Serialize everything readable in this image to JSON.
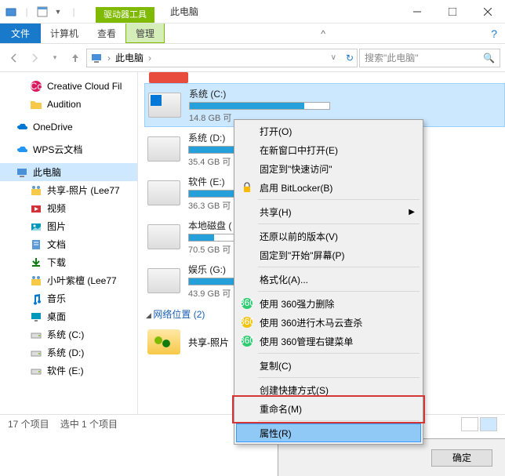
{
  "titlebar": {
    "context_tab": "驱动器工具",
    "context_title": "此电脑"
  },
  "ribbon": {
    "file": "文件",
    "tabs": [
      "计算机",
      "查看",
      "管理"
    ]
  },
  "nav": {
    "breadcrumb": "此电脑",
    "search_placeholder": "搜索\"此电脑\""
  },
  "tree": [
    {
      "label": "Creative Cloud Fil",
      "type": "cc",
      "child": true
    },
    {
      "label": "Audition",
      "type": "folder",
      "child": true
    },
    {
      "label": "",
      "spacer": true
    },
    {
      "label": "OneDrive",
      "type": "onedrive",
      "child": false
    },
    {
      "label": "",
      "spacer": true
    },
    {
      "label": "WPS云文档",
      "type": "wps",
      "child": false
    },
    {
      "label": "",
      "spacer": true
    },
    {
      "label": "此电脑",
      "type": "pc",
      "child": false,
      "selected": true
    },
    {
      "label": "共享-照片 (Lee77",
      "type": "share",
      "child": true
    },
    {
      "label": "视频",
      "type": "video",
      "child": true
    },
    {
      "label": "图片",
      "type": "pictures",
      "child": true
    },
    {
      "label": "文档",
      "type": "docs",
      "child": true
    },
    {
      "label": "下载",
      "type": "downloads",
      "child": true
    },
    {
      "label": "小叶紫檀 (Lee77",
      "type": "share",
      "child": true
    },
    {
      "label": "音乐",
      "type": "music",
      "child": true
    },
    {
      "label": "桌面",
      "type": "desktop",
      "child": true
    },
    {
      "label": "系统 (C:)",
      "type": "drive",
      "child": true
    },
    {
      "label": "系统 (D:)",
      "type": "drive",
      "child": true
    },
    {
      "label": "软件 (E:)",
      "type": "drive",
      "child": true
    }
  ],
  "drives": [
    {
      "name": "系统 (C:)",
      "size": "14.8 GB 可",
      "fill": 82,
      "selected": true,
      "win": true
    },
    {
      "name": "系统 (D:)",
      "size": "35.4 GB 可",
      "fill": 64
    },
    {
      "name": "软件 (E:)",
      "size": "36.3 GB 可",
      "fill": 62
    },
    {
      "name": "本地磁盘 (",
      "size": "70.5 GB 可",
      "fill": 18
    },
    {
      "name": "娱乐 (G:)",
      "size": "43.9 GB 可",
      "fill": 55
    }
  ],
  "network": {
    "header": "网络位置 (2)",
    "item": "共享-照片"
  },
  "statusbar": {
    "count": "17 个项目",
    "selected": "选中 1 个项目"
  },
  "ctxmenu": [
    {
      "label": "打开(O)"
    },
    {
      "label": "在新窗口中打开(E)"
    },
    {
      "label": "固定到\"快速访问\""
    },
    {
      "label": "启用 BitLocker(B)",
      "icon": "bitlocker"
    },
    {
      "sep": true
    },
    {
      "label": "共享(H)",
      "sub": true
    },
    {
      "sep": true
    },
    {
      "label": "还原以前的版本(V)"
    },
    {
      "label": "固定到\"开始\"屏幕(P)"
    },
    {
      "sep": true
    },
    {
      "label": "格式化(A)..."
    },
    {
      "sep": true
    },
    {
      "label": "使用 360强力删除",
      "icon": "360"
    },
    {
      "label": "使用 360进行木马云查杀",
      "icon": "360y"
    },
    {
      "label": "使用 360管理右键菜单",
      "icon": "360g"
    },
    {
      "sep": true
    },
    {
      "label": "复制(C)"
    },
    {
      "sep": true
    },
    {
      "label": "创建快捷方式(S)"
    },
    {
      "label": "重命名(M)"
    },
    {
      "sep": true
    },
    {
      "label": "属性(R)",
      "hover": true
    }
  ],
  "dialog": {
    "ok": "确定"
  }
}
